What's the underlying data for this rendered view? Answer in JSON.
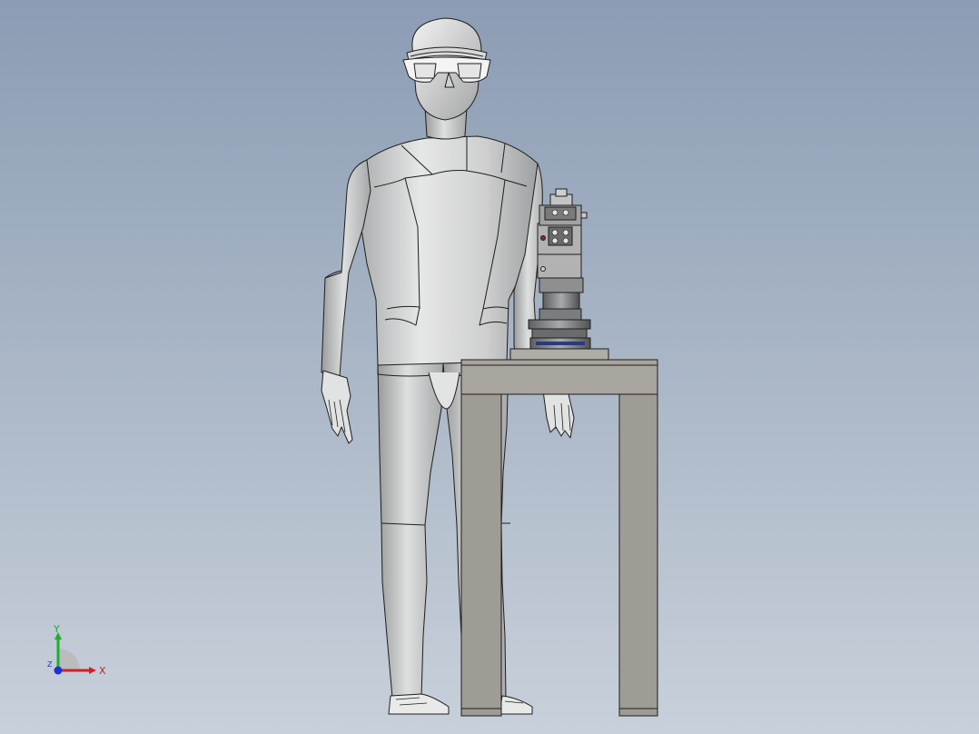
{
  "viewport": {
    "background_top": "#8b9cb4",
    "background_bottom": "#c8d0da",
    "model_fill": "#cfd0d0",
    "table_fill": "#a39f99",
    "edge_color": "#1e1e1e"
  },
  "model": {
    "parts": [
      "human-mannequin",
      "work-table",
      "fixture-assembly"
    ]
  },
  "triad": {
    "x_label": "X",
    "y_label": "Y",
    "z_label": "Z",
    "x_color": "#d42020",
    "y_color": "#18b22a",
    "z_color": "#2030d8"
  }
}
